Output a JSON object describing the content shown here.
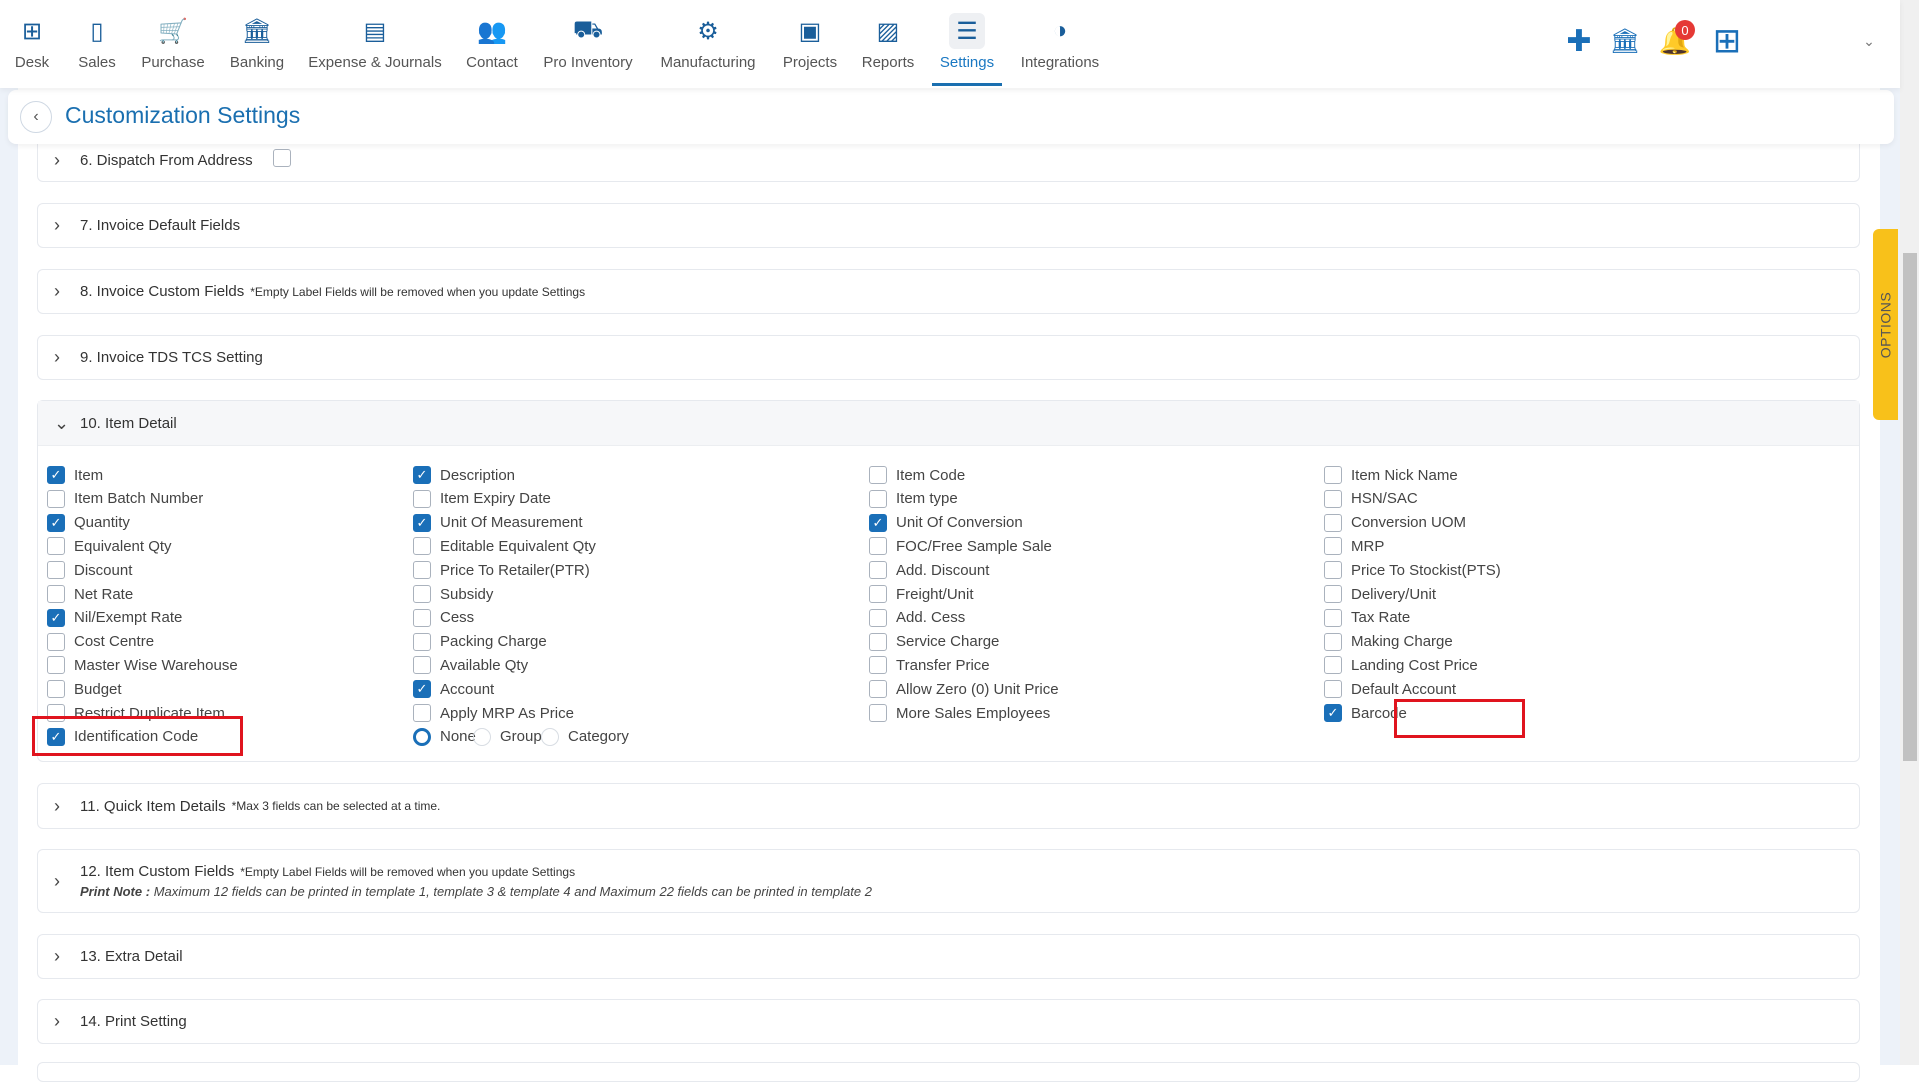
{
  "nav": {
    "tabs": [
      {
        "label": "Desk",
        "icon": "desk-icon",
        "glyph": "⊞"
      },
      {
        "label": "Sales",
        "icon": "receipt-icon",
        "glyph": "▯"
      },
      {
        "label": "Purchase",
        "icon": "cart-icon",
        "glyph": "🛒"
      },
      {
        "label": "Banking",
        "icon": "bank-icon",
        "glyph": "🏛"
      },
      {
        "label": "Expense & Journals",
        "icon": "journal-icon",
        "glyph": "▤"
      },
      {
        "label": "Contact",
        "icon": "contact-icon",
        "glyph": "👥"
      },
      {
        "label": "Pro Inventory",
        "icon": "inventory-icon",
        "glyph": "⛟"
      },
      {
        "label": "Manufacturing",
        "icon": "manufacturing-icon",
        "glyph": "⚙"
      },
      {
        "label": "Projects",
        "icon": "projects-icon",
        "glyph": "▣"
      },
      {
        "label": "Reports",
        "icon": "reports-icon",
        "glyph": "▨"
      },
      {
        "label": "Settings",
        "icon": "sliders-icon",
        "glyph": "☰"
      },
      {
        "label": "Integrations",
        "icon": "integrations-icon",
        "glyph": "◑"
      }
    ],
    "active": "Settings",
    "notification_count": "0"
  },
  "page": {
    "title": "Customization Settings"
  },
  "sections": {
    "s6": "6. Dispatch From Address",
    "s7": "7. Invoice Default Fields",
    "s8": "8. Invoice Custom Fields",
    "s8_note": "*Empty Label Fields will be removed when you update Settings",
    "s9": "9. Invoice TDS TCS Setting",
    "s10": "10. Item Detail",
    "s11": "11. Quick Item Details",
    "s11_note": "*Max 3 fields can be selected at a time.",
    "s12": "12. Item Custom Fields",
    "s12_note": "*Empty Label Fields will be removed when you update Settings",
    "s12_print_label": "Print Note :",
    "s12_print_text": "Maximum 12 fields can be printed in template 1, template 3 & template 4 and Maximum 22 fields can be printed in template 2",
    "s13": "13. Extra Detail",
    "s14": "14. Print Setting"
  },
  "item_detail": {
    "columns": [
      [
        {
          "label": "Item",
          "checked": true
        },
        {
          "label": "Item Batch Number",
          "checked": false
        },
        {
          "label": "Quantity",
          "checked": true
        },
        {
          "label": "Equivalent Qty",
          "checked": false
        },
        {
          "label": "Discount",
          "checked": false
        },
        {
          "label": "Net Rate",
          "checked": false
        },
        {
          "label": "Nil/Exempt Rate",
          "checked": true
        },
        {
          "label": "Cost Centre",
          "checked": false
        },
        {
          "label": "Master Wise Warehouse",
          "checked": false
        },
        {
          "label": "Budget",
          "checked": false
        },
        {
          "label": "Restrict Duplicate Item",
          "checked": false
        },
        {
          "label": "Identification Code",
          "checked": true
        }
      ],
      [
        {
          "label": "Description",
          "checked": true
        },
        {
          "label": "Item Expiry Date",
          "checked": false
        },
        {
          "label": "Unit Of Measurement",
          "checked": true
        },
        {
          "label": "Editable Equivalent Qty",
          "checked": false
        },
        {
          "label": "Price To Retailer(PTR)",
          "checked": false
        },
        {
          "label": "Subsidy",
          "checked": false
        },
        {
          "label": "Cess",
          "checked": false
        },
        {
          "label": "Packing Charge",
          "checked": false
        },
        {
          "label": "Available Qty",
          "checked": false
        },
        {
          "label": "Account",
          "checked": true
        },
        {
          "label": "Apply MRP As Price",
          "checked": false
        }
      ],
      [
        {
          "label": "Item Code",
          "checked": false
        },
        {
          "label": "Item type",
          "checked": false
        },
        {
          "label": "Unit Of Conversion",
          "checked": true
        },
        {
          "label": "FOC/Free Sample Sale",
          "checked": false
        },
        {
          "label": "Add. Discount",
          "checked": false
        },
        {
          "label": "Freight/Unit",
          "checked": false
        },
        {
          "label": "Add. Cess",
          "checked": false
        },
        {
          "label": "Service Charge",
          "checked": false
        },
        {
          "label": "Transfer Price",
          "checked": false
        },
        {
          "label": "Allow Zero (0) Unit Price",
          "checked": false
        },
        {
          "label": "More Sales Employees",
          "checked": false
        }
      ],
      [
        {
          "label": "Item Nick Name",
          "checked": false
        },
        {
          "label": "HSN/SAC",
          "checked": false
        },
        {
          "label": "Conversion UOM",
          "checked": false
        },
        {
          "label": "MRP",
          "checked": false
        },
        {
          "label": "Price To Stockist(PTS)",
          "checked": false
        },
        {
          "label": "Delivery/Unit",
          "checked": false
        },
        {
          "label": "Tax Rate",
          "checked": false
        },
        {
          "label": "Making Charge",
          "checked": false
        },
        {
          "label": "Landing Cost Price",
          "checked": false
        },
        {
          "label": "Default Account",
          "checked": false
        },
        {
          "label": "Barcode",
          "checked": true
        }
      ]
    ],
    "radio_options": [
      {
        "label": "None",
        "selected": true
      },
      {
        "label": "Group",
        "selected": false
      },
      {
        "label": "Category",
        "selected": false
      }
    ]
  },
  "side_tab": "OPTIONS",
  "colors": {
    "accent": "#1a6fb8",
    "highlight": "#e0141e",
    "options_tab": "#f8c11a"
  }
}
